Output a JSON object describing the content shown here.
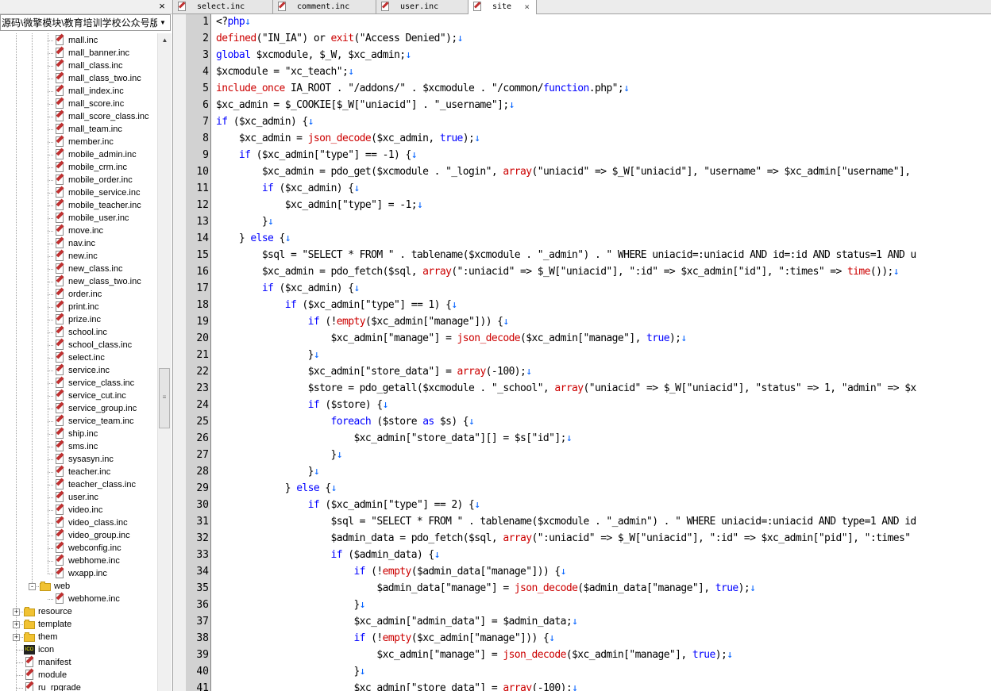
{
  "panel": {
    "close_glyph": "×",
    "folder_select": "源码\\微擎模块\\教育培训学校公众号版",
    "dropdown_glyph": "▼"
  },
  "tree": {
    "items": [
      {
        "label": "mall.inc",
        "icon": "file-icon"
      },
      {
        "label": "mall_banner.inc",
        "icon": "file-icon"
      },
      {
        "label": "mall_class.inc",
        "icon": "file-icon"
      },
      {
        "label": "mall_class_two.inc",
        "icon": "file-icon"
      },
      {
        "label": "mall_index.inc",
        "icon": "file-icon"
      },
      {
        "label": "mall_score.inc",
        "icon": "file-icon"
      },
      {
        "label": "mall_score_class.inc",
        "icon": "file-icon"
      },
      {
        "label": "mall_team.inc",
        "icon": "file-icon"
      },
      {
        "label": "member.inc",
        "icon": "file-icon"
      },
      {
        "label": "mobile_admin.inc",
        "icon": "file-icon"
      },
      {
        "label": "mobile_crm.inc",
        "icon": "file-icon"
      },
      {
        "label": "mobile_order.inc",
        "icon": "file-icon"
      },
      {
        "label": "mobile_service.inc",
        "icon": "file-icon"
      },
      {
        "label": "mobile_teacher.inc",
        "icon": "file-icon"
      },
      {
        "label": "mobile_user.inc",
        "icon": "file-icon"
      },
      {
        "label": "move.inc",
        "icon": "file-icon"
      },
      {
        "label": "nav.inc",
        "icon": "file-icon"
      },
      {
        "label": "new.inc",
        "icon": "file-icon"
      },
      {
        "label": "new_class.inc",
        "icon": "file-icon"
      },
      {
        "label": "new_class_two.inc",
        "icon": "file-icon"
      },
      {
        "label": "order.inc",
        "icon": "file-icon"
      },
      {
        "label": "print.inc",
        "icon": "file-icon"
      },
      {
        "label": "prize.inc",
        "icon": "file-icon"
      },
      {
        "label": "school.inc",
        "icon": "file-icon"
      },
      {
        "label": "school_class.inc",
        "icon": "file-icon"
      },
      {
        "label": "select.inc",
        "icon": "file-icon"
      },
      {
        "label": "service.inc",
        "icon": "file-icon"
      },
      {
        "label": "service_class.inc",
        "icon": "file-icon"
      },
      {
        "label": "service_cut.inc",
        "icon": "file-icon"
      },
      {
        "label": "service_group.inc",
        "icon": "file-icon"
      },
      {
        "label": "service_team.inc",
        "icon": "file-icon"
      },
      {
        "label": "ship.inc",
        "icon": "file-icon"
      },
      {
        "label": "sms.inc",
        "icon": "file-icon"
      },
      {
        "label": "sysasyn.inc",
        "icon": "file-icon"
      },
      {
        "label": "teacher.inc",
        "icon": "file-icon"
      },
      {
        "label": "teacher_class.inc",
        "icon": "file-icon"
      },
      {
        "label": "user.inc",
        "icon": "file-icon"
      },
      {
        "label": "video.inc",
        "icon": "file-icon"
      },
      {
        "label": "video_class.inc",
        "icon": "file-icon"
      },
      {
        "label": "video_group.inc",
        "icon": "file-icon"
      },
      {
        "label": "webconfig.inc",
        "icon": "file-icon"
      },
      {
        "label": "webhome.inc",
        "icon": "file-icon"
      },
      {
        "label": "wxapp.inc",
        "icon": "file-icon"
      },
      {
        "label": "web",
        "icon": "folder-icon",
        "expander": "-"
      },
      {
        "label": "webhome.inc",
        "icon": "file-icon"
      },
      {
        "label": "resource",
        "icon": "folder-icon",
        "expander": "+"
      },
      {
        "label": "template",
        "icon": "folder-icon",
        "expander": "+"
      },
      {
        "label": "them",
        "icon": "folder-icon",
        "expander": "+"
      },
      {
        "label": "icon",
        "icon": "icon-file-icon"
      },
      {
        "label": "manifest",
        "icon": "file-icon"
      },
      {
        "label": "module",
        "icon": "file-icon"
      },
      {
        "label": "ru_rpgrade",
        "icon": "file-icon"
      }
    ]
  },
  "tabs": [
    {
      "label": "select.inc",
      "active": false
    },
    {
      "label": "comment.inc",
      "active": false
    },
    {
      "label": "user.inc",
      "active": false
    },
    {
      "label": "site",
      "active": true,
      "close": "×"
    }
  ],
  "scroll": {
    "up_glyph": "▲",
    "grip_glyph": "≡"
  },
  "code": {
    "newline_glyph": "↓",
    "lines": [
      [
        [
          "t",
          "<?"
        ],
        [
          "k",
          "php"
        ],
        [
          "n"
        ]
      ],
      [
        [
          "f",
          "defined"
        ],
        [
          "t",
          "(\"IN_IA\") or "
        ],
        [
          "f",
          "exit"
        ],
        [
          "t",
          "(\"Access Denied\");"
        ],
        [
          "n"
        ]
      ],
      [
        [
          "k",
          "global"
        ],
        [
          "t",
          " $xcmodule, $_W, $xc_admin;"
        ],
        [
          "n"
        ]
      ],
      [
        [
          "t",
          "$xcmodule = \"xc_teach\";"
        ],
        [
          "n"
        ]
      ],
      [
        [
          "f",
          "include_once"
        ],
        [
          "t",
          " IA_ROOT . \"/addons/\" . $xcmodule . \"/common/"
        ],
        [
          "b",
          "function"
        ],
        [
          "t",
          ".php\";"
        ],
        [
          "n"
        ]
      ],
      [
        [
          "t",
          "$xc_admin = $_COOKIE[$_W[\"uniacid\"] . \"_username\"];"
        ],
        [
          "n"
        ]
      ],
      [
        [
          "k",
          "if"
        ],
        [
          "t",
          " ($xc_admin) {"
        ],
        [
          "n"
        ]
      ],
      [
        [
          "t",
          "    $xc_admin = "
        ],
        [
          "f",
          "json_decode"
        ],
        [
          "t",
          "($xc_admin, "
        ],
        [
          "k",
          "true"
        ],
        [
          "t",
          ");"
        ],
        [
          "n"
        ]
      ],
      [
        [
          "t",
          "    "
        ],
        [
          "k",
          "if"
        ],
        [
          "t",
          " ($xc_admin[\"type\"] == -1) {"
        ],
        [
          "n"
        ]
      ],
      [
        [
          "t",
          "        $xc_admin = pdo_get($xcmodule . \"_login\", "
        ],
        [
          "f",
          "array"
        ],
        [
          "t",
          "(\"uniacid\" => $_W[\"uniacid\"], \"username\" => $xc_admin[\"username\"],"
        ]
      ],
      [
        [
          "t",
          "        "
        ],
        [
          "k",
          "if"
        ],
        [
          "t",
          " ($xc_admin) {"
        ],
        [
          "n"
        ]
      ],
      [
        [
          "t",
          "            $xc_admin[\"type\"] = -1;"
        ],
        [
          "n"
        ]
      ],
      [
        [
          "t",
          "        }"
        ],
        [
          "n"
        ]
      ],
      [
        [
          "t",
          "    } "
        ],
        [
          "k",
          "else"
        ],
        [
          "t",
          " {"
        ],
        [
          "n"
        ]
      ],
      [
        [
          "t",
          "        $sql = \"SELECT * FROM \" . tablename($xcmodule . \"_admin\") . \" WHERE uniacid=:uniacid AND id=:id AND status=1 AND u"
        ]
      ],
      [
        [
          "t",
          "        $xc_admin = pdo_fetch($sql, "
        ],
        [
          "f",
          "array"
        ],
        [
          "t",
          "(\":uniacid\" => $_W[\"uniacid\"], \":id\" => $xc_admin[\"id\"], \":times\" => "
        ],
        [
          "f",
          "time"
        ],
        [
          "t",
          "());"
        ],
        [
          "n"
        ]
      ],
      [
        [
          "t",
          "        "
        ],
        [
          "k",
          "if"
        ],
        [
          "t",
          " ($xc_admin) {"
        ],
        [
          "n"
        ]
      ],
      [
        [
          "t",
          "            "
        ],
        [
          "k",
          "if"
        ],
        [
          "t",
          " ($xc_admin[\"type\"] == 1) {"
        ],
        [
          "n"
        ]
      ],
      [
        [
          "t",
          "                "
        ],
        [
          "k",
          "if"
        ],
        [
          "t",
          " (!"
        ],
        [
          "f",
          "empty"
        ],
        [
          "t",
          "($xc_admin[\"manage\"])) {"
        ],
        [
          "n"
        ]
      ],
      [
        [
          "t",
          "                    $xc_admin[\"manage\"] = "
        ],
        [
          "f",
          "json_decode"
        ],
        [
          "t",
          "($xc_admin[\"manage\"], "
        ],
        [
          "k",
          "true"
        ],
        [
          "t",
          ");"
        ],
        [
          "n"
        ]
      ],
      [
        [
          "t",
          "                }"
        ],
        [
          "n"
        ]
      ],
      [
        [
          "t",
          "                $xc_admin[\"store_data\"] = "
        ],
        [
          "f",
          "array"
        ],
        [
          "t",
          "(-100);"
        ],
        [
          "n"
        ]
      ],
      [
        [
          "t",
          "                $store = pdo_getall($xcmodule . \"_school\", "
        ],
        [
          "f",
          "array"
        ],
        [
          "t",
          "(\"uniacid\" => $_W[\"uniacid\"], \"status\" => 1, \"admin\" => $x"
        ]
      ],
      [
        [
          "t",
          "                "
        ],
        [
          "k",
          "if"
        ],
        [
          "t",
          " ($store) {"
        ],
        [
          "n"
        ]
      ],
      [
        [
          "t",
          "                    "
        ],
        [
          "k",
          "foreach"
        ],
        [
          "t",
          " ($store "
        ],
        [
          "k",
          "as"
        ],
        [
          "t",
          " $s) {"
        ],
        [
          "n"
        ]
      ],
      [
        [
          "t",
          "                        $xc_admin[\"store_data\"][] = $s[\"id\"];"
        ],
        [
          "n"
        ]
      ],
      [
        [
          "t",
          "                    }"
        ],
        [
          "n"
        ]
      ],
      [
        [
          "t",
          "                }"
        ],
        [
          "n"
        ]
      ],
      [
        [
          "t",
          "            } "
        ],
        [
          "k",
          "else"
        ],
        [
          "t",
          " {"
        ],
        [
          "n"
        ]
      ],
      [
        [
          "t",
          "                "
        ],
        [
          "k",
          "if"
        ],
        [
          "t",
          " ($xc_admin[\"type\"] == 2) {"
        ],
        [
          "n"
        ]
      ],
      [
        [
          "t",
          "                    $sql = \"SELECT * FROM \" . tablename($xcmodule . \"_admin\") . \" WHERE uniacid=:uniacid AND type=1 AND id"
        ]
      ],
      [
        [
          "t",
          "                    $admin_data = pdo_fetch($sql, "
        ],
        [
          "f",
          "array"
        ],
        [
          "t",
          "(\":uniacid\" => $_W[\"uniacid\"], \":id\" => $xc_admin[\"pid\"], \":times\""
        ]
      ],
      [
        [
          "t",
          "                    "
        ],
        [
          "k",
          "if"
        ],
        [
          "t",
          " ($admin_data) {"
        ],
        [
          "n"
        ]
      ],
      [
        [
          "t",
          "                        "
        ],
        [
          "k",
          "if"
        ],
        [
          "t",
          " (!"
        ],
        [
          "f",
          "empty"
        ],
        [
          "t",
          "($admin_data[\"manage\"])) {"
        ],
        [
          "n"
        ]
      ],
      [
        [
          "t",
          "                            $admin_data[\"manage\"] = "
        ],
        [
          "f",
          "json_decode"
        ],
        [
          "t",
          "($admin_data[\"manage\"], "
        ],
        [
          "k",
          "true"
        ],
        [
          "t",
          ");"
        ],
        [
          "n"
        ]
      ],
      [
        [
          "t",
          "                        }"
        ],
        [
          "n"
        ]
      ],
      [
        [
          "t",
          "                        $xc_admin[\"admin_data\"] = $admin_data;"
        ],
        [
          "n"
        ]
      ],
      [
        [
          "t",
          "                        "
        ],
        [
          "k",
          "if"
        ],
        [
          "t",
          " (!"
        ],
        [
          "f",
          "empty"
        ],
        [
          "t",
          "($xc_admin[\"manage\"])) {"
        ],
        [
          "n"
        ]
      ],
      [
        [
          "t",
          "                            $xc_admin[\"manage\"] = "
        ],
        [
          "f",
          "json_decode"
        ],
        [
          "t",
          "($xc_admin[\"manage\"], "
        ],
        [
          "k",
          "true"
        ],
        [
          "t",
          ");"
        ],
        [
          "n"
        ]
      ],
      [
        [
          "t",
          "                        }"
        ],
        [
          "n"
        ]
      ],
      [
        [
          "t",
          "                        $xc_admin[\"store_data\"] = "
        ],
        [
          "f",
          "array"
        ],
        [
          "t",
          "(-100);"
        ],
        [
          "n"
        ]
      ]
    ]
  }
}
